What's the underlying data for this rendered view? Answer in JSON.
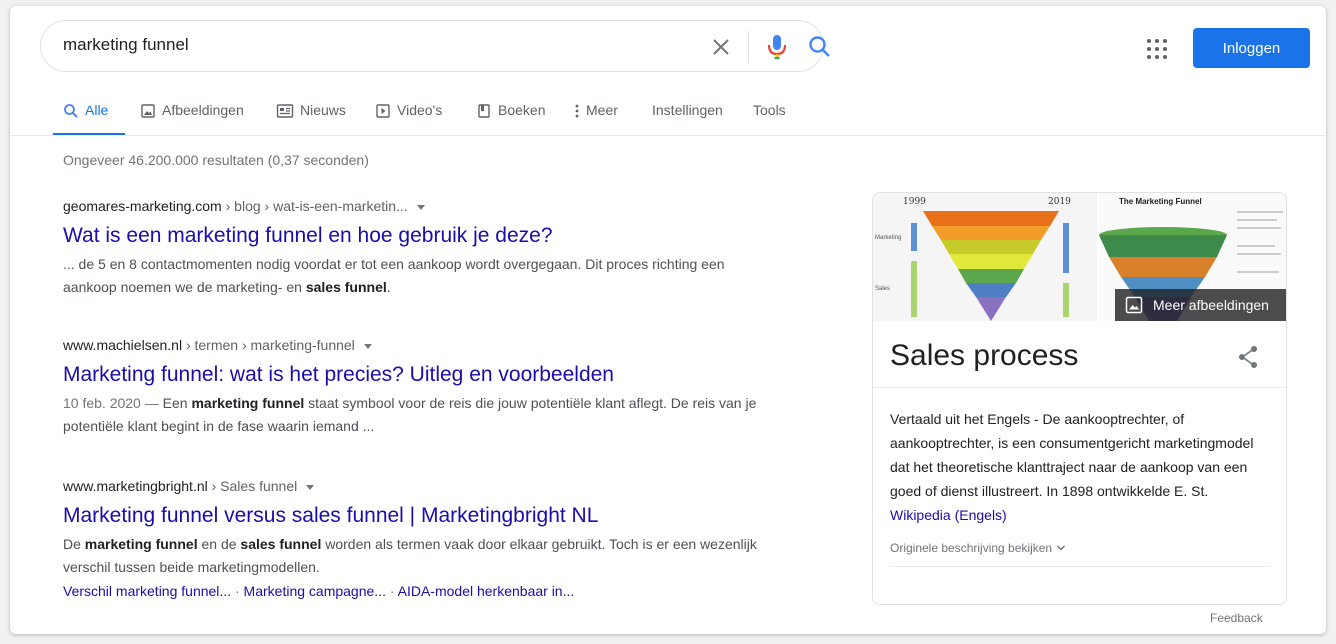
{
  "search": {
    "query": "marketing funnel"
  },
  "header": {
    "login_label": "Inloggen"
  },
  "tabs": [
    {
      "label": "Alle"
    },
    {
      "label": "Afbeeldingen"
    },
    {
      "label": "Nieuws"
    },
    {
      "label": "Video's"
    },
    {
      "label": "Boeken"
    },
    {
      "label": "Meer"
    },
    {
      "label": "Instellingen"
    },
    {
      "label": "Tools"
    }
  ],
  "stats": "Ongeveer 46.200.000 resultaten (0,37 seconden)",
  "results": [
    {
      "domain": "geomares-marketing.com",
      "path": " › blog › wat-is-een-marketin...",
      "title": "Wat is een marketing funnel en hoe gebruik je deze?",
      "snippet_1": "... de 5 en 8 contactmomenten nodig voordat er tot een aankoop wordt overgegaan. Dit proces richting een aankoop noemen we de marketing- en ",
      "snippet_bold_1": "sales funnel",
      "snippet_2": "."
    },
    {
      "domain": "www.machielsen.nl",
      "path": " › termen › marketing-funnel",
      "title": "Marketing funnel: wat is het precies? Uitleg en voorbeelden",
      "date": "10 feb. 2020 — ",
      "snippet_1": "Een ",
      "snippet_bold_1": "marketing funnel",
      "snippet_2": " staat symbool voor de reis die jouw potentiële klant aflegt. De reis van je potentiële klant begint in de fase waarin iemand ..."
    },
    {
      "domain": "www.marketingbright.nl",
      "path": " › Sales funnel",
      "title": "Marketing funnel versus sales funnel | Marketingbright NL",
      "snippet_1": "De ",
      "snippet_bold_1": "marketing funnel",
      "snippet_2": " en de ",
      "snippet_bold_2": "sales funnel",
      "snippet_3": " worden als termen vaak door elkaar gebruikt. Toch is er een wezenlijk verschil tussen beide marketingmodellen.",
      "sitelinks": [
        "Verschil marketing funnel...",
        "Marketing campagne...",
        "AIDA-model herkenbaar in..."
      ],
      "sitelink_separator": " · "
    }
  ],
  "knowledge_panel": {
    "image_1": {
      "year_left": "1999",
      "year_right": "2019",
      "label_marketing": "Marketing",
      "label_sales": "Sales"
    },
    "image_2": {
      "title": "The Marketing Funnel"
    },
    "more_images_label": "Meer afbeeldingen",
    "title": "Sales process",
    "description": "Vertaald uit het Engels - De aankooptrechter, of aankooptrechter, is een consumentgericht marketingmodel dat het theoretische klanttraject naar de aankoop van een goed of dienst illustreert. In 1898 ontwikkelde E. St. ",
    "source_link": "Wikipedia (Engels)",
    "original_description": "Originele beschrijving bekijken"
  },
  "feedback_label": "Feedback",
  "colors": {
    "accent_blue": "#1a73e8",
    "link_blue": "#1a0dab",
    "mic_red": "#ea4335",
    "mic_yellow": "#fbbc04",
    "mic_green": "#34a853"
  }
}
